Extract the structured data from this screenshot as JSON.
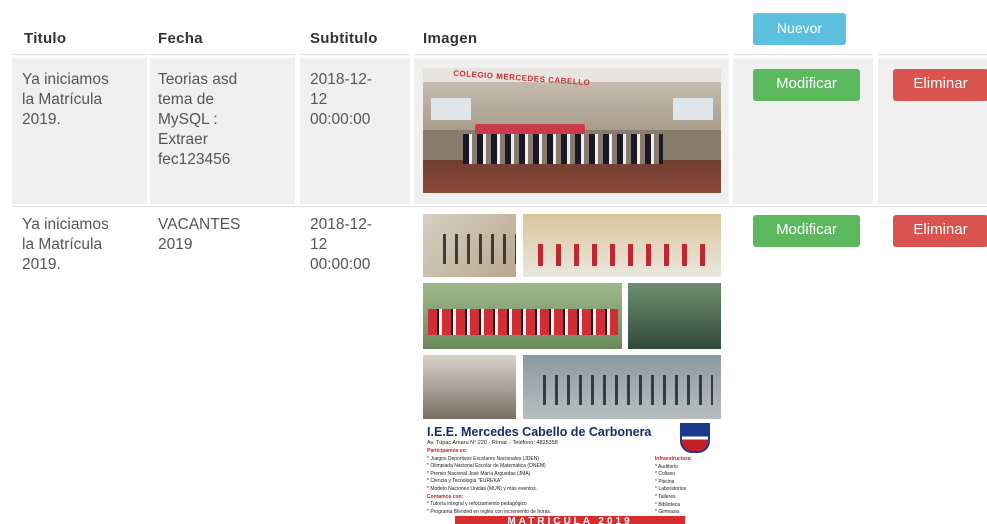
{
  "table": {
    "headers": {
      "titulo": "Titulo",
      "fecha": "Fecha",
      "subtitulo": "Subtitulo",
      "imagen": "Imagen"
    },
    "new_button": "Nuevor",
    "rows": [
      {
        "titulo": [
          "Ya iniciamos",
          "la Matrícula",
          "2019."
        ],
        "fecha": [
          "Teorias asd",
          "tema de",
          "MySQL :",
          "Extraer",
          "fec123456"
        ],
        "subtitulo": [
          "2018-12-",
          "12",
          "00:00:00"
        ],
        "image_sign": "COLEGIO MERCEDES CABELLO",
        "modify_label": "Modificar",
        "delete_label": "Eliminar"
      },
      {
        "titulo": [
          "Ya iniciamos",
          "la Matrícula",
          "2019."
        ],
        "fecha": [
          "VACANTES",
          "2019"
        ],
        "subtitulo": [
          "2018-12-",
          "12",
          "00:00:00"
        ],
        "modify_label": "Modificar",
        "delete_label": "Eliminar",
        "flyer": {
          "school_name": "I.E.E. Mercedes Cabello de Carbonera",
          "address": "Av. Túpac Amaru N° 220 - Rímac - Teléfono: 4825358",
          "participamos_title": "Participamos en:",
          "participamos_items": [
            "* Juegos Deportivos Escolares Nacionales (JDEN)",
            "* Olimpiada Nacional Escolar de Matemática (ONEM)",
            "* Premio Nacional José María Arguedas (JMA)",
            "* Ciencia y Tecnología \"EUREKA\"",
            "* Modelo Naciones Unidas (MUN) y más eventos."
          ],
          "contamos_title": "Contamos con:",
          "contamos_items": [
            "* Tutoría integral y reforzamiento pedagógico",
            "* Programa Blended en inglés con incremento de horas."
          ],
          "infra_title": "Infraestructura:",
          "infra_items": [
            "* Auditorio",
            "* Coliseo",
            "* Piscina",
            "* Laboratorios",
            "* Talleres",
            "* Biblioteca",
            "* Gimnasio"
          ],
          "banner": "MATRÍCULA 2019"
        }
      }
    ]
  },
  "colors": {
    "info": "#5bc0de",
    "success": "#5cb85c",
    "danger": "#d9534f",
    "cell_gray": "#f0f0f0"
  }
}
